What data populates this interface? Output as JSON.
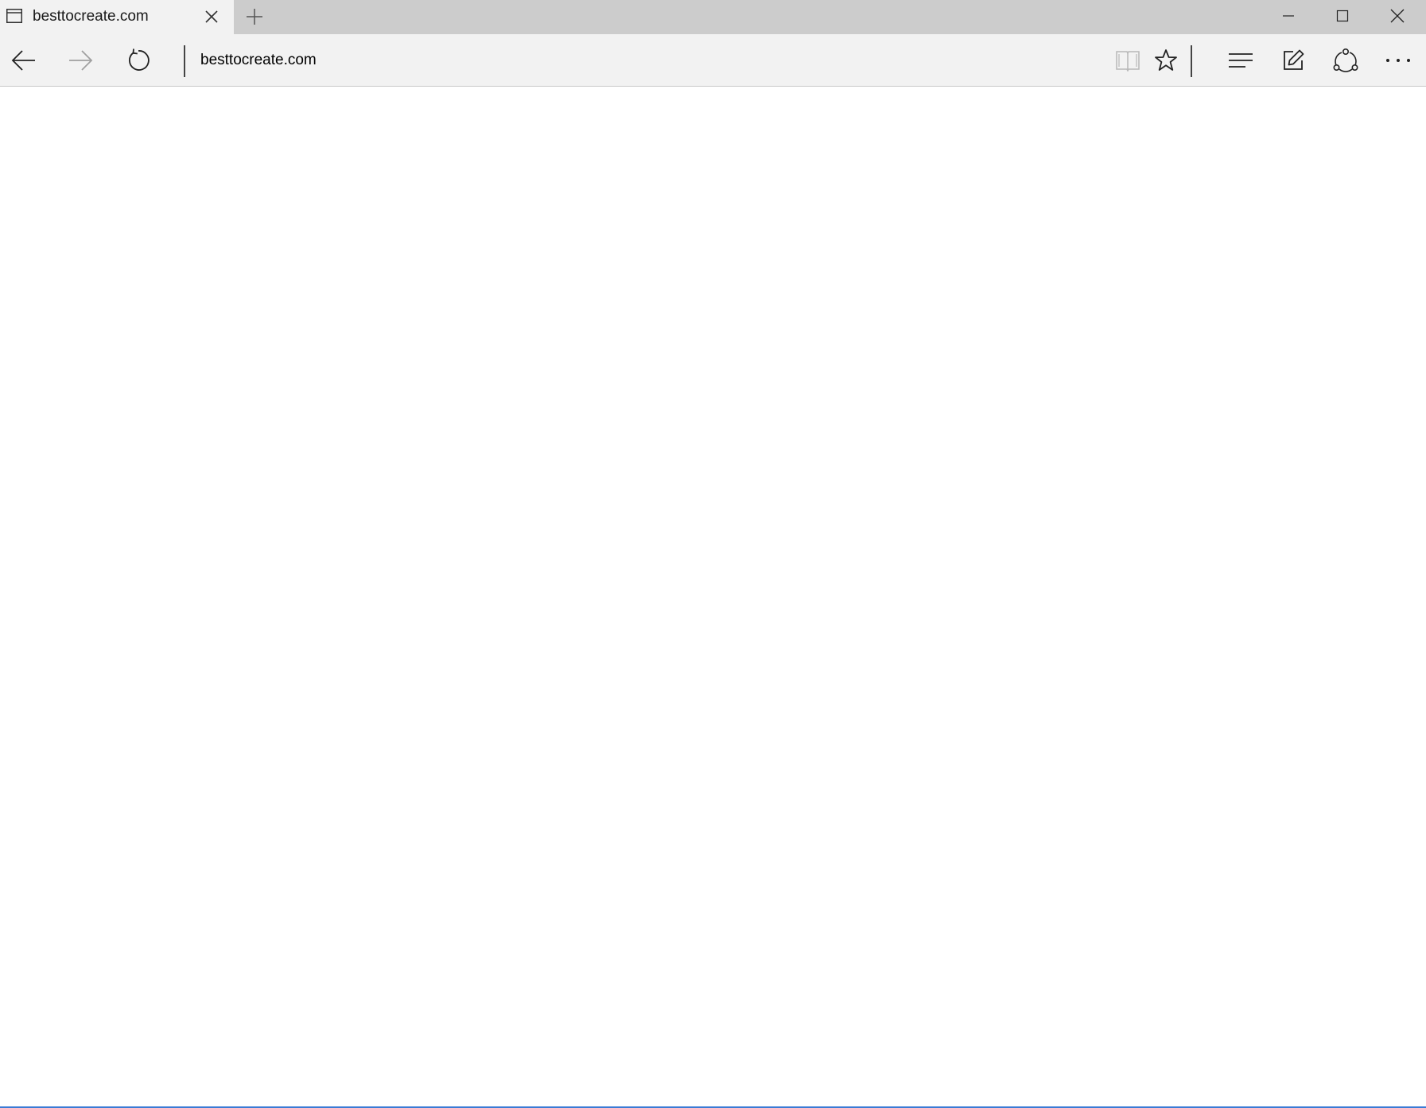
{
  "tab": {
    "title": "besttocreate.com",
    "page_icon": "page-icon",
    "close_icon": "close-icon"
  },
  "new_tab": {
    "icon": "plus-icon"
  },
  "window_controls": {
    "minimize_icon": "minimize-icon",
    "maximize_icon": "maximize-icon",
    "close_icon": "close-icon"
  },
  "toolbar": {
    "back_icon": "arrow-left-icon",
    "forward_icon": "arrow-right-icon",
    "forward_enabled": false,
    "refresh_icon": "refresh-icon",
    "address": "besttocreate.com",
    "reading_view_icon": "book-icon",
    "reading_view_enabled": false,
    "favorite_icon": "star-icon",
    "hub_icon": "hub-icon",
    "web_note_icon": "pen-icon",
    "share_icon": "share-icon",
    "more_icon": "more-icon"
  },
  "colors": {
    "tabstrip": "#cccccc",
    "toolbar": "#f2f2f2",
    "content": "#ffffff",
    "accent_line": "#3a7bd5"
  }
}
